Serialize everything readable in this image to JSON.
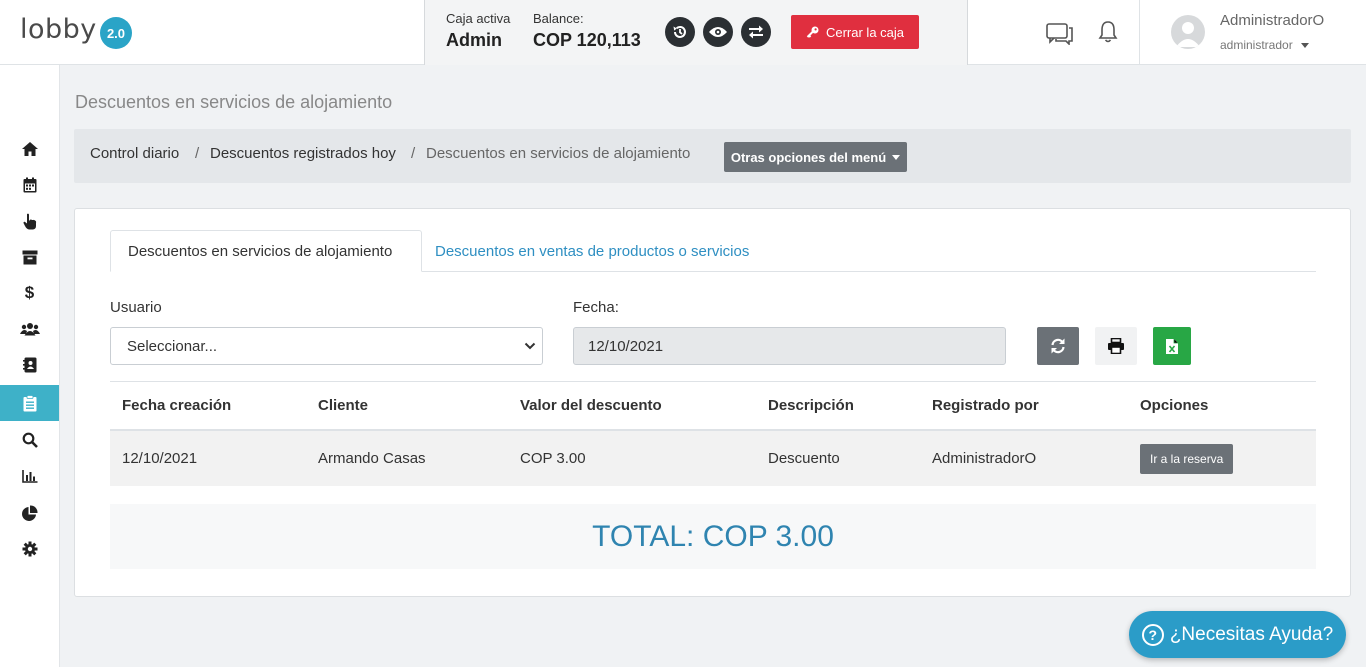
{
  "header": {
    "logo_text": "lobby",
    "logo_version": "2.0",
    "cashbox_label": "Caja activa",
    "cashbox_value": "Admin",
    "balance_label": "Balance:",
    "balance_value": "COP 120,113",
    "close_button": "Cerrar la caja",
    "user_name": "AdministradorO",
    "user_role": "administrador",
    "accent_color": "#2aa4c7",
    "danger_color": "#e02f3f"
  },
  "sidebar": {
    "items": [
      {
        "icon": "home-icon"
      },
      {
        "icon": "calendar-icon"
      },
      {
        "icon": "pointer-hand-icon"
      },
      {
        "icon": "archive-icon"
      },
      {
        "icon": "dollar-icon"
      },
      {
        "icon": "users-icon"
      },
      {
        "icon": "contacts-icon"
      },
      {
        "icon": "clipboard-icon",
        "active": true
      },
      {
        "icon": "search-icon"
      },
      {
        "icon": "bar-chart-icon"
      },
      {
        "icon": "pie-chart-icon"
      },
      {
        "icon": "gear-icon"
      }
    ]
  },
  "page": {
    "title": "Descuentos en servicios de alojamiento"
  },
  "breadcrumb": {
    "items": [
      "Control diario",
      "Descuentos registrados hoy",
      "Descuentos en servicios de alojamiento"
    ],
    "separator": "/",
    "menu_button": "Otras opciones del menú"
  },
  "tabs": [
    {
      "label": "Descuentos en servicios de alojamiento",
      "active": true
    },
    {
      "label": "Descuentos en ventas de productos o servicios",
      "active": false
    }
  ],
  "filters": {
    "user_label": "Usuario",
    "user_value": "Seleccionar...",
    "date_label": "Fecha:",
    "date_value": "12/10/2021"
  },
  "table": {
    "columns": [
      "Fecha creación",
      "Cliente",
      "Valor del descuento",
      "Descripción",
      "Registrado por",
      "Opciones"
    ],
    "rows": [
      {
        "fecha": "12/10/2021",
        "cliente": "Armando Casas",
        "valor": "COP 3.00",
        "descripcion": "Descuento",
        "registrado": "AdministradorO",
        "opcion": "Ir a la reserva"
      }
    ]
  },
  "total": "TOTAL: COP 3.00",
  "help_button": "¿Necesitas Ayuda?"
}
